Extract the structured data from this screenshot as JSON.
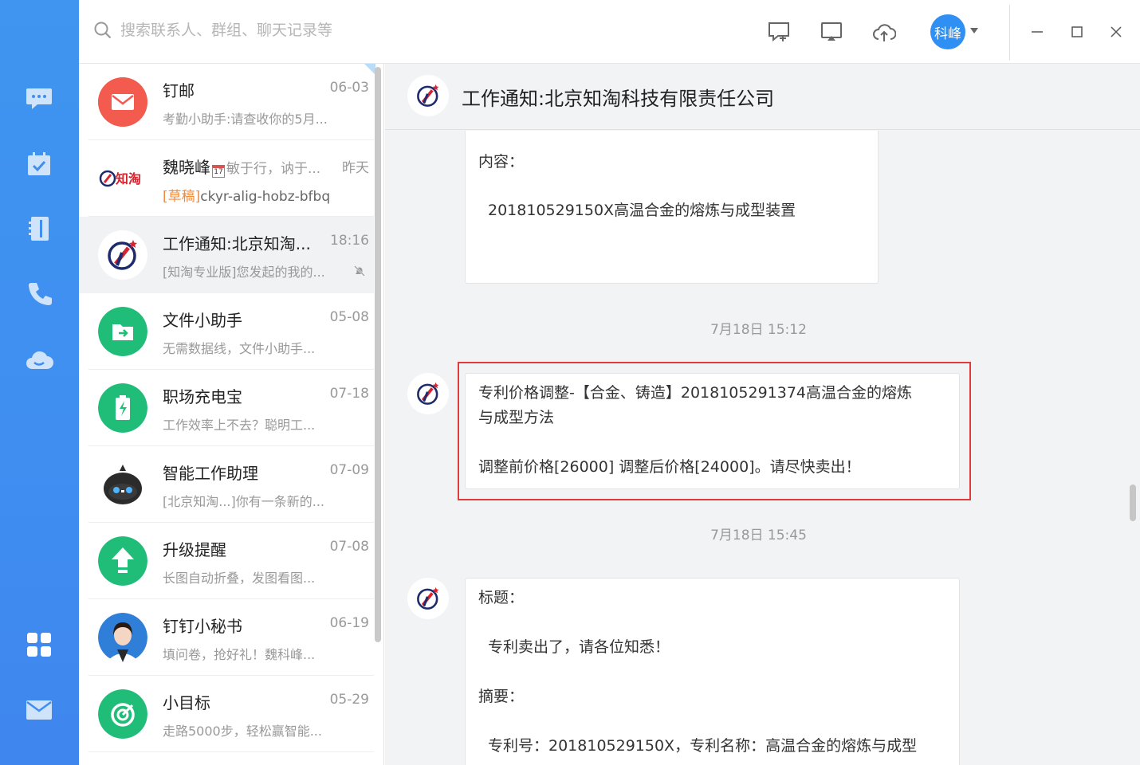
{
  "search": {
    "placeholder": "搜索联系人、群组、聊天记录等"
  },
  "user": {
    "avatar_label": "科峰"
  },
  "conversations": [
    {
      "name": "钉邮",
      "time": "06-03",
      "preview": "考勤小助手:请查收你的5月..."
    },
    {
      "name": "魏晓峰",
      "name_suffix": "敏于行，讷于...",
      "time": "昨天",
      "draft_tag": "[草稿]",
      "preview": "ckyr-alig-hobz-bfbq",
      "avatar_text": "知淘"
    },
    {
      "name": "工作通知:北京知淘...",
      "time": "18:16",
      "preview": "[知淘专业版]您发起的我的..."
    },
    {
      "name": "文件小助手",
      "time": "05-08",
      "preview": "无需数据线，文件小助手..."
    },
    {
      "name": "职场充电宝",
      "time": "07-18",
      "preview": "工作效率上不去？聪明工..."
    },
    {
      "name": "智能工作助理",
      "time": "07-09",
      "preview": "[北京知淘...]你有一条新的..."
    },
    {
      "name": "升级提醒",
      "time": "07-08",
      "preview": "长图自动折叠，发图看图..."
    },
    {
      "name": "钉钉小秘书",
      "time": "06-19",
      "preview": "填问卷，抢好礼！魏科峰..."
    },
    {
      "name": "小目标",
      "time": "05-29",
      "preview": "走路5000步，轻松赢智能..."
    }
  ],
  "chat": {
    "title": "工作通知:北京知淘科技有限责任公司",
    "msg1": {
      "label": "内容：",
      "body": "201810529150X高温合金的熔炼与成型装置"
    },
    "ts1": "7月18日 15:12",
    "msg2": {
      "line1": "专利价格调整-【合金、铸造】2018105291374高温合金的熔炼",
      "line2": "与成型方法",
      "line3": "调整前价格[26000] 调整后价格[24000]。请尽快卖出！"
    },
    "ts2": "7月18日 15:45",
    "msg3": {
      "title_label": "标题：",
      "title_body": "专利卖出了，请各位知悉！",
      "abstract_label": "摘要：",
      "abstract_body": "专利号：201810529150X，专利名称：高温合金的熔炼与成型"
    }
  },
  "colors": {
    "rail": "#3f8ef0",
    "accent": "#2f8ff2",
    "highlight": "#e23b3b"
  }
}
